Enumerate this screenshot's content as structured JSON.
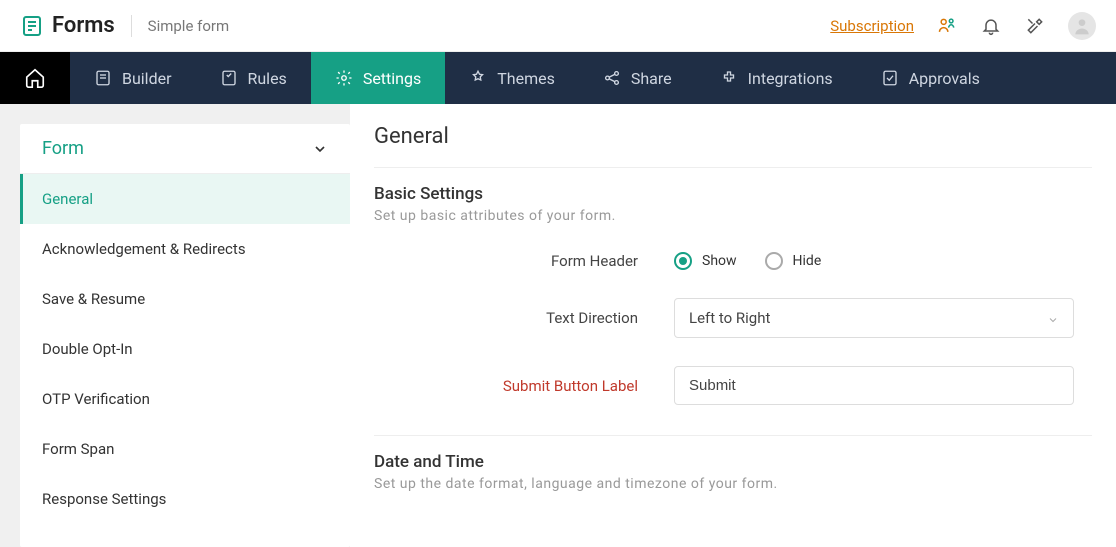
{
  "header": {
    "logo_text": "Forms",
    "breadcrumb": "Simple form",
    "subscription": "Subscription"
  },
  "nav": {
    "items": [
      {
        "label": "Builder"
      },
      {
        "label": "Rules"
      },
      {
        "label": "Settings"
      },
      {
        "label": "Themes"
      },
      {
        "label": "Share"
      },
      {
        "label": "Integrations"
      },
      {
        "label": "Approvals"
      }
    ]
  },
  "sidebar": {
    "heading": "Form",
    "items": [
      {
        "label": "General"
      },
      {
        "label": "Acknowledgement & Redirects"
      },
      {
        "label": "Save & Resume"
      },
      {
        "label": "Double Opt-In"
      },
      {
        "label": "OTP Verification"
      },
      {
        "label": "Form Span"
      },
      {
        "label": "Response Settings"
      }
    ]
  },
  "main": {
    "title": "General",
    "basic": {
      "title": "Basic Settings",
      "subtitle": "Set up basic attributes of your form.",
      "form_header_label": "Form Header",
      "form_header_show": "Show",
      "form_header_hide": "Hide",
      "text_direction_label": "Text Direction",
      "text_direction_value": "Left to Right",
      "submit_button_label": "Submit Button Label",
      "submit_button_value": "Submit"
    },
    "datetime": {
      "title": "Date and Time",
      "subtitle": "Set up the date format, language and timezone of your form."
    }
  }
}
